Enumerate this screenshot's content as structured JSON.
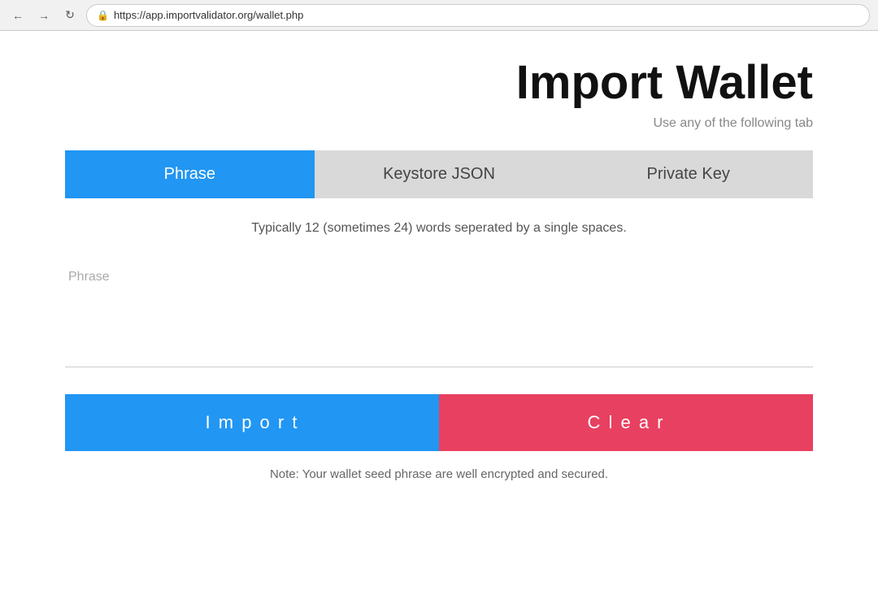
{
  "browser": {
    "url": "https://app.importvalidator.org/wallet.php"
  },
  "header": {
    "title": "Import Wallet",
    "subtitle": "Use any of the following tab"
  },
  "tabs": [
    {
      "id": "phrase",
      "label": "Phrase",
      "active": true
    },
    {
      "id": "keystore",
      "label": "Keystore JSON",
      "active": false
    },
    {
      "id": "privatekey",
      "label": "Private Key",
      "active": false
    }
  ],
  "main": {
    "description": "Typically 12 (sometimes 24) words seperated by a single spaces.",
    "phrase_label": "Phrase",
    "phrase_placeholder": ""
  },
  "buttons": {
    "import_label": "I m p o r t",
    "clear_label": "C l e a r"
  },
  "footer": {
    "note": "Note: Your wallet seed phrase are well encrypted and secured."
  }
}
